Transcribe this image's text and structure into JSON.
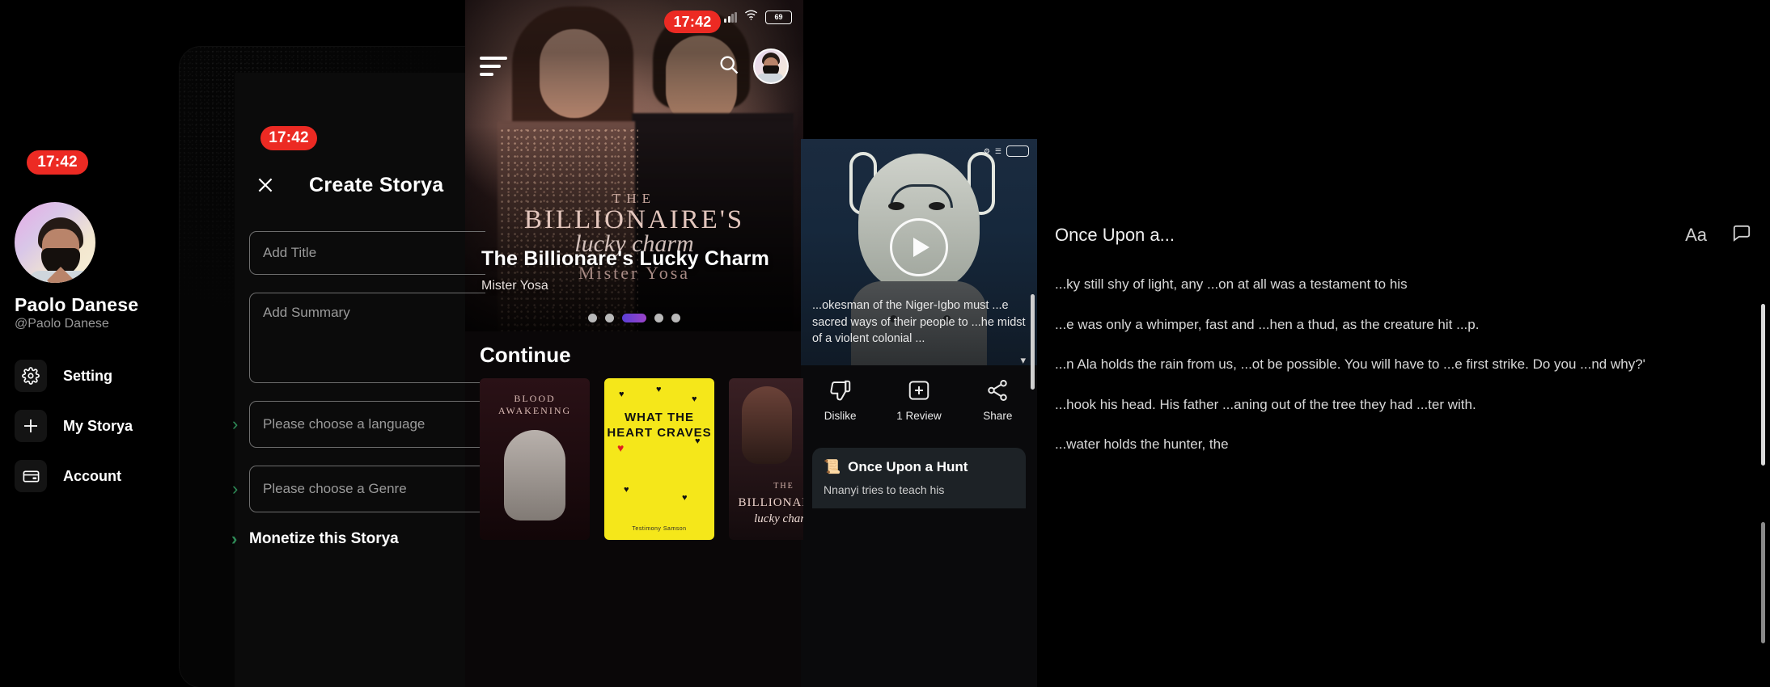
{
  "drawer": {
    "time": "17:42",
    "user_name": "Paolo Danese",
    "user_handle": "@Paolo Danese",
    "items": [
      {
        "label": "Setting",
        "icon": "gear-icon",
        "chevron": "›"
      },
      {
        "label": "My Storya",
        "icon": "plus-icon",
        "chevron": "›"
      },
      {
        "label": "Account",
        "icon": "card-icon",
        "chevron": "›"
      }
    ]
  },
  "create_storya": {
    "time": "17:42",
    "title": "Create Storya",
    "close_label": "✕",
    "title_placeholder": "Add Title",
    "summary_placeholder": "Add Summary",
    "language_placeholder": "Please choose a language",
    "genre_placeholder": "Please choose a Genre",
    "monetize_label": "Monetize this Storya",
    "chevron": "›"
  },
  "home": {
    "time": "17:42",
    "battery": "69",
    "hero_title": "The Billionare's Lucky Charm",
    "hero_author": "Mister Yosa",
    "cover_line1": "THE",
    "cover_line2": "BILLIONAIRE'S",
    "cover_line3": "lucky charm",
    "cover_line4": "Mister Yosa",
    "section_title": "Continue",
    "dots_total": 5,
    "dots_active": 2,
    "books": [
      {
        "title": "BLOOD AWAKENING"
      },
      {
        "title": "WHAT THE HEART CRAVES",
        "subtitle": "Testimony Samson"
      },
      {
        "line1": "THE",
        "line2": "BILLIONARE'S",
        "line3": "lucky charm"
      }
    ]
  },
  "video": {
    "description": "...okesman of the Niger-Igbo must ...e sacred ways of their people to ...he midst of a violent colonial ...",
    "caret": "▾",
    "actions": [
      {
        "label": "Dislike",
        "icon": "thumbs-down-icon"
      },
      {
        "label": "1 Review",
        "icon": "review-icon"
      },
      {
        "label": "Share",
        "icon": "share-icon"
      }
    ],
    "rec_icon": "book-icon",
    "rec_title": "Once Upon a Hunt",
    "rec_body": "Nnanyi tries to teach his"
  },
  "reader": {
    "title": "Once Upon a...",
    "font_button": "Aa",
    "comment_icon": "comment-icon",
    "paragraphs": [
      "...ky still shy of light, any ...on at all was a testament to his",
      "...e was only a whimper, fast and ...hen a thud, as the creature hit ...p.",
      "...n Ala holds the rain from us, ...ot be possible. You will have to ...e first strike. Do you ...nd why?'",
      "...hook his head. His father ...aning out of the tree they had ...ter with.",
      "...water holds the hunter, the"
    ]
  },
  "colors": {
    "accent_red": "#ec2a23",
    "accent_green": "#2e8b57",
    "accent_purple": "#7b3fd0"
  }
}
